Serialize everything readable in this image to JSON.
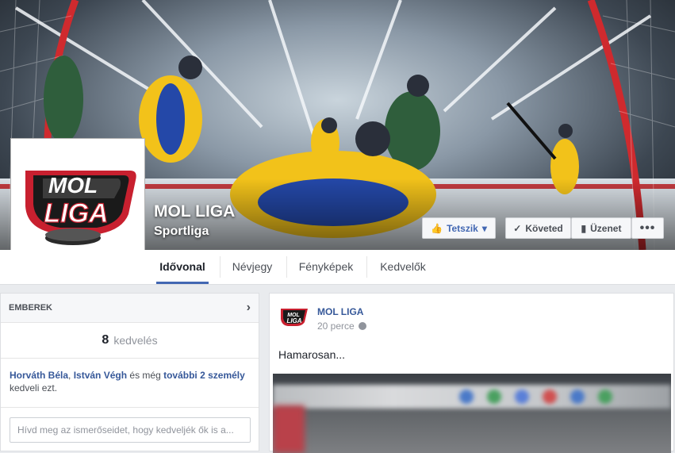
{
  "page": {
    "name": "MOL LIGA",
    "category": "Sportliga"
  },
  "profile_logo": {
    "line1": "MOL",
    "line2": "LIGA"
  },
  "actions": {
    "like_label": "Tetszik",
    "follow_label": "Követed",
    "message_label": "Üzenet",
    "more_label": "•••"
  },
  "tabs": [
    {
      "label": "Idővonal",
      "active": true
    },
    {
      "label": "Névjegy",
      "active": false
    },
    {
      "label": "Fényképek",
      "active": false
    },
    {
      "label": "Kedvelők",
      "active": false
    }
  ],
  "people": {
    "header": "EMBEREK",
    "likes_count": "8",
    "likes_word": "kedvelés",
    "friend1": "Horváth Béla",
    "sep": ", ",
    "friend2": "István Végh",
    "and_more_text": " és még ",
    "more_link": "további 2 személy",
    "likes_this": "kedveli ezt.",
    "invite_placeholder": "Hívd meg az ismerőseidet, hogy kedveljék ők is a..."
  },
  "post": {
    "author": "MOL LIGA",
    "time": "20 perce",
    "text": "Hamarosan..."
  },
  "colors": {
    "facebook_blue": "#4267b2",
    "link_blue": "#365899",
    "logo_red": "#c8202f"
  }
}
